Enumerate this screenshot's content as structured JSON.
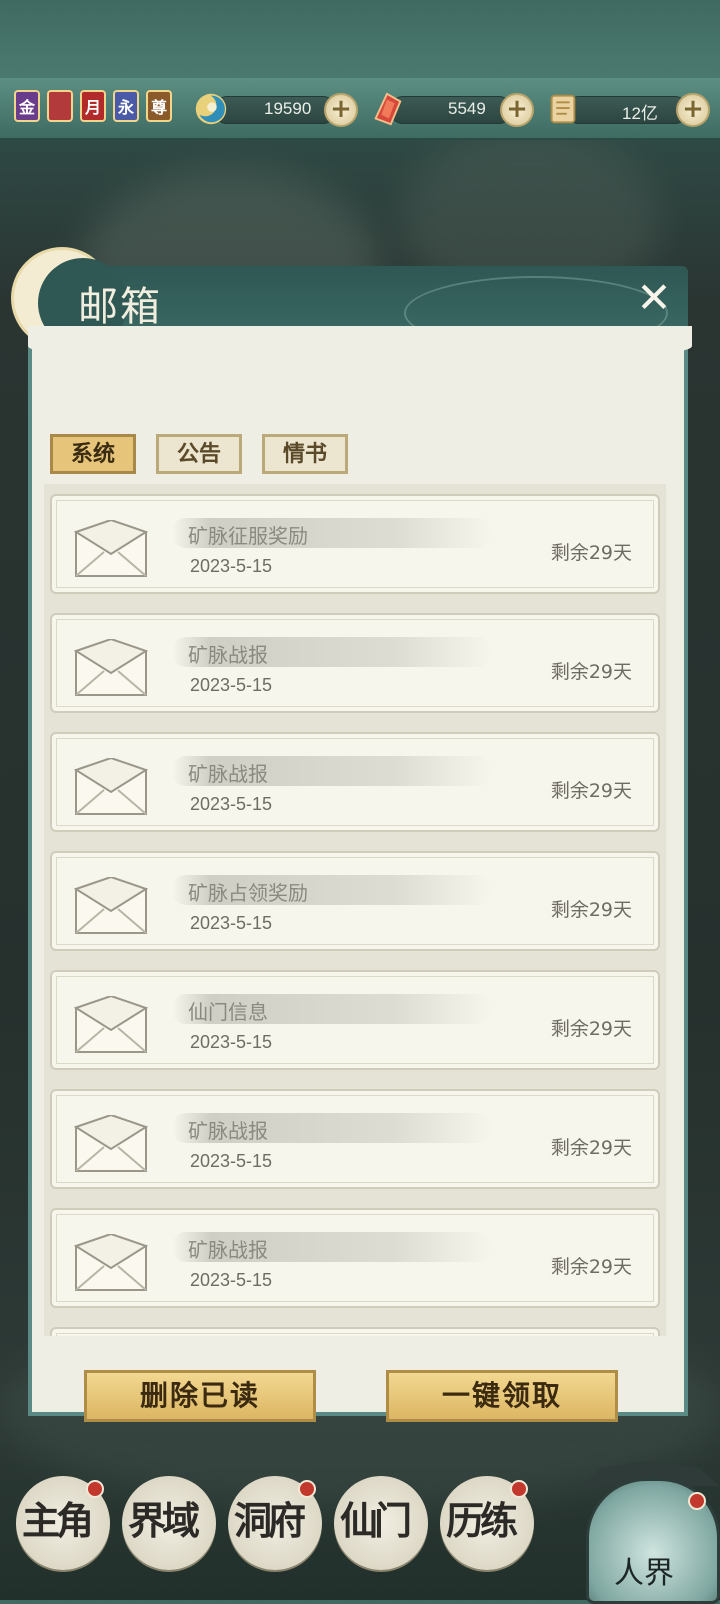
{
  "top_badges": [
    {
      "label": "金",
      "color": "#6a3c8c"
    },
    {
      "label": "",
      "color": "#b23a3a"
    },
    {
      "label": "月",
      "color": "#b22a2a"
    },
    {
      "label": "永",
      "color": "#4b5aa8"
    },
    {
      "label": "尊",
      "color": "#8a5a2a"
    }
  ],
  "resources": [
    {
      "name": "spirit-jade",
      "value": "19590",
      "icon_color": "#3aa0c8"
    },
    {
      "name": "red-crystal",
      "value": "5549",
      "icon_color": "#d04a3a"
    },
    {
      "name": "scroll",
      "value": "12亿",
      "icon_color": "#e6c888"
    }
  ],
  "mailbox": {
    "title": "邮箱",
    "close_label": "✕",
    "tabs": [
      {
        "label": "系统",
        "active": true
      },
      {
        "label": "公告",
        "active": false
      },
      {
        "label": "情书",
        "active": false
      }
    ],
    "mails": [
      {
        "subject": "矿脉征服奖励",
        "date": "2023-5-15",
        "remain": "剩余29天"
      },
      {
        "subject": "矿脉战报",
        "date": "2023-5-15",
        "remain": "剩余29天"
      },
      {
        "subject": "矿脉战报",
        "date": "2023-5-15",
        "remain": "剩余29天"
      },
      {
        "subject": "矿脉占领奖励",
        "date": "2023-5-15",
        "remain": "剩余29天"
      },
      {
        "subject": "仙门信息",
        "date": "2023-5-15",
        "remain": "剩余29天"
      },
      {
        "subject": "矿脉战报",
        "date": "2023-5-15",
        "remain": "剩余29天"
      },
      {
        "subject": "矿脉战报",
        "date": "2023-5-15",
        "remain": "剩余29天"
      }
    ],
    "delete_read_label": "删除已读",
    "claim_all_label": "一键领取"
  },
  "bottom_nav": [
    {
      "label": "主角",
      "badge": true
    },
    {
      "label": "界域",
      "badge": false
    },
    {
      "label": "洞府",
      "badge": true
    },
    {
      "label": "仙门",
      "badge": false
    },
    {
      "label": "历练",
      "badge": true
    }
  ],
  "realm_button": {
    "label": "人界"
  }
}
